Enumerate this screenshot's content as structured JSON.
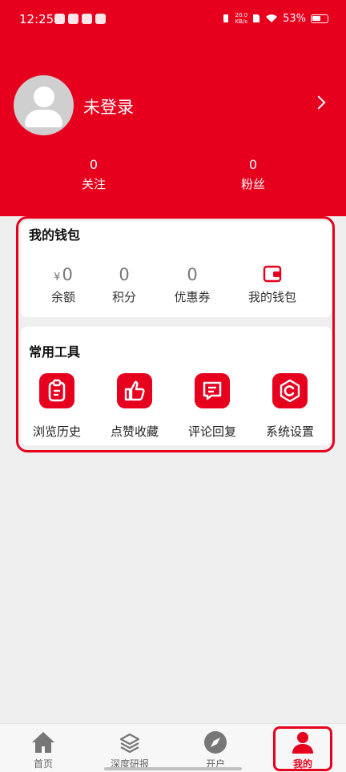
{
  "status_bar": {
    "time": "12:25",
    "net_speed_value": "20.0",
    "net_speed_unit": "KB/s",
    "battery": "53%"
  },
  "profile": {
    "name": "未登录"
  },
  "stats": [
    {
      "value": "0",
      "label": "关注"
    },
    {
      "value": "0",
      "label": "粉丝"
    }
  ],
  "wallet": {
    "title": "我的钱包",
    "balance": {
      "currency": "¥",
      "value": "0",
      "label": "余额"
    },
    "points": {
      "value": "0",
      "label": "积分"
    },
    "coupons": {
      "value": "0",
      "label": "优惠券"
    },
    "my_wallet": {
      "label": "我的钱包",
      "icon": "wallet-icon"
    }
  },
  "tools": {
    "title": "常用工具",
    "items": [
      {
        "label": "浏览历史",
        "icon": "history-icon"
      },
      {
        "label": "点赞收藏",
        "icon": "thumbs-up-icon"
      },
      {
        "label": "评论回复",
        "icon": "comment-icon"
      },
      {
        "label": "系统设置",
        "icon": "settings-icon"
      }
    ]
  },
  "tabbar": [
    {
      "label": "首页",
      "icon": "home-icon"
    },
    {
      "label": "深度研报",
      "icon": "layers-icon"
    },
    {
      "label": "开户",
      "icon": "compass-icon"
    },
    {
      "label": "我的",
      "icon": "user-icon",
      "active": true
    }
  ],
  "colors": {
    "accent": "#e6001e",
    "background": "#efefef"
  }
}
